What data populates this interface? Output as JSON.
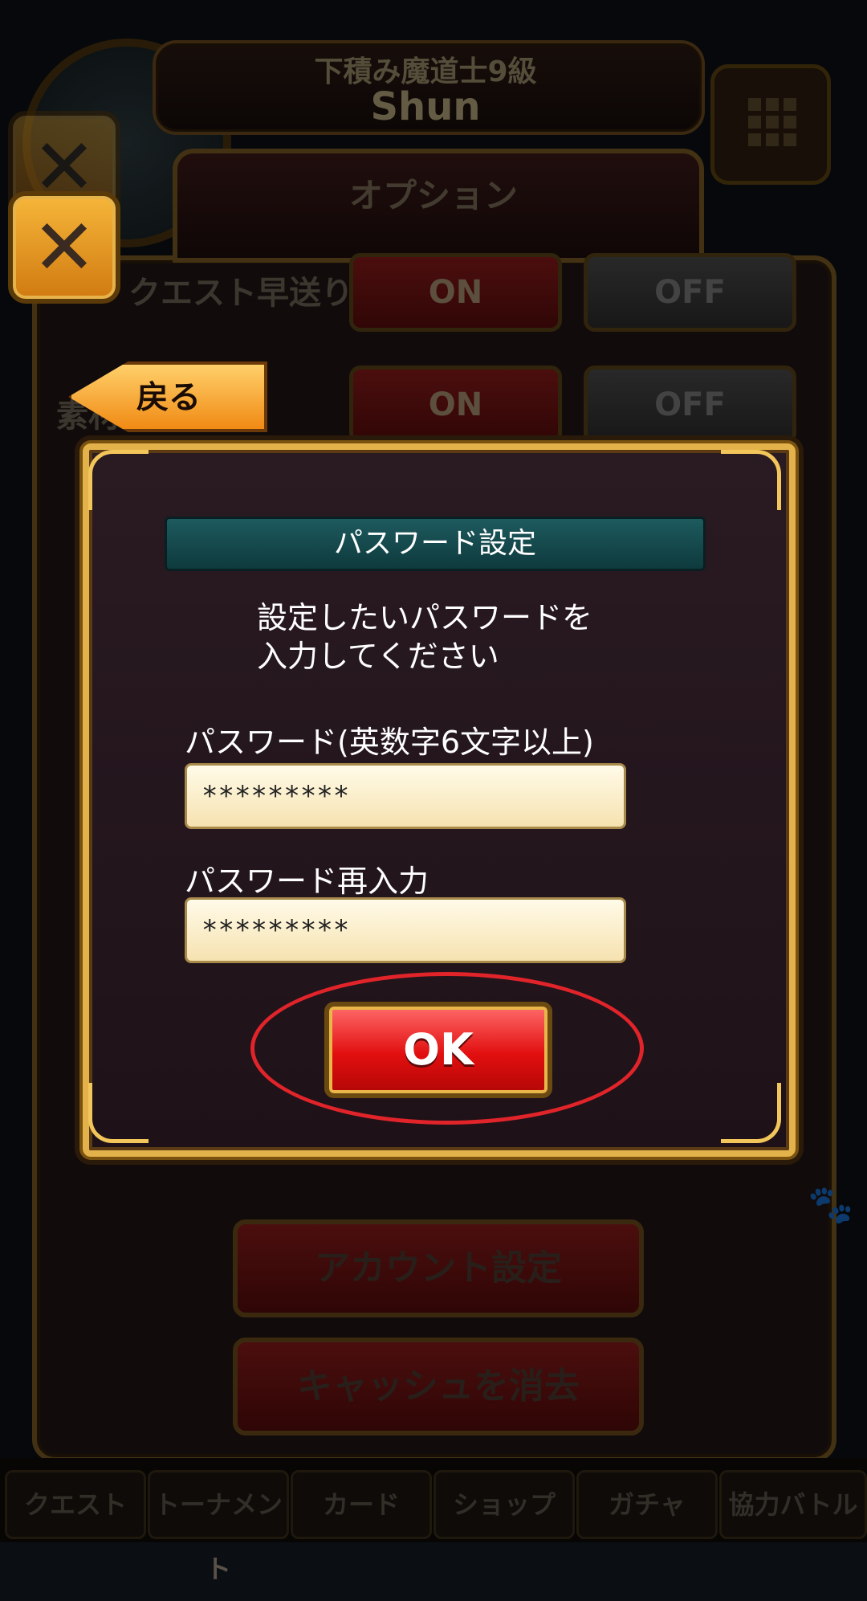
{
  "header": {
    "player_title": "下積み魔道士9級",
    "player_name": "Shun"
  },
  "option": {
    "title": "オプション",
    "rows": [
      {
        "label": "クエスト早送り",
        "on": "ON",
        "off": "OFF"
      },
      {
        "label": "素材振り分け",
        "on": "ON",
        "off": "OFF"
      }
    ],
    "account_button": "アカウント設定",
    "cache_button": "キャッシュを消去"
  },
  "nav": {
    "items": [
      "クエスト",
      "トーナメント",
      "カード",
      "ショップ",
      "ガチャ",
      "協力バトル"
    ]
  },
  "back_button": "戻る",
  "dialog": {
    "title": "パスワード設定",
    "instruction": "設定したいパスワードを\n入力してください",
    "password_label": "パスワード(英数字6文字以上)",
    "password_value": "*********",
    "confirm_label": "パスワード再入力",
    "confirm_value": "*********",
    "ok_label": "OK"
  },
  "colors": {
    "frame_gold": "#e3b24a",
    "header_teal": "#1d5a5e",
    "ok_red": "#e20f0f",
    "highlight": "#e0242a"
  },
  "icons": {
    "close": "close-icon",
    "grid": "grid-icon",
    "paw": "paw-icon"
  }
}
